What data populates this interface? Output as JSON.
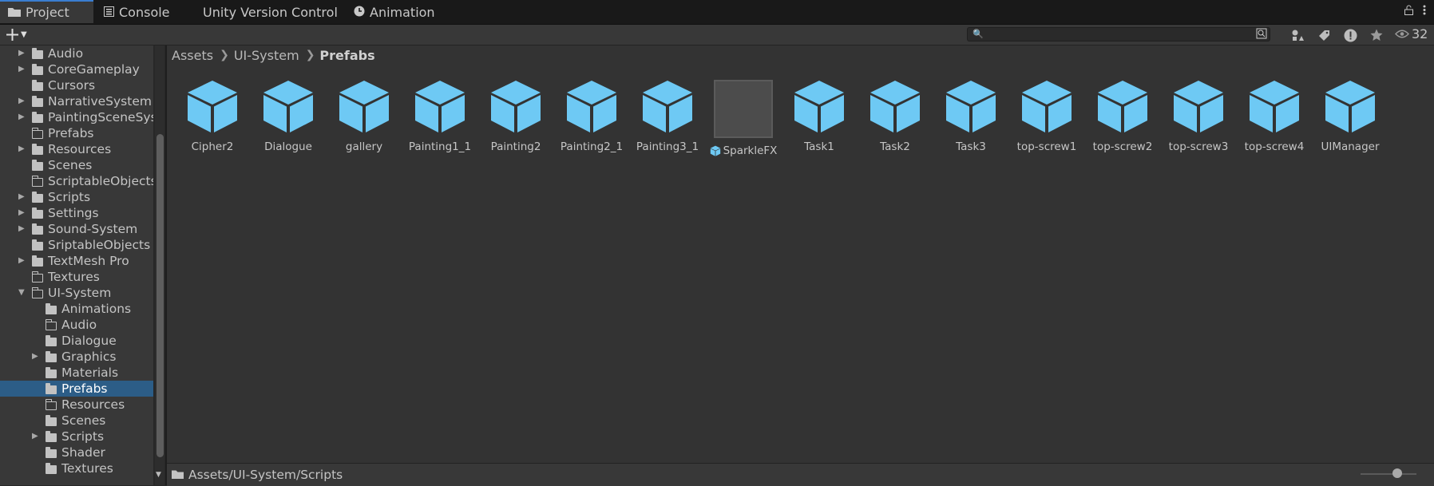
{
  "tabs": [
    {
      "label": "Project",
      "icon": "folder-icon",
      "active": true
    },
    {
      "label": "Console",
      "icon": "console-icon",
      "active": false
    },
    {
      "label": "Unity Version Control",
      "icon": "",
      "active": false
    },
    {
      "label": "Animation",
      "icon": "clock-icon",
      "active": false
    }
  ],
  "toolbar": {
    "create_icon": "plus-icon",
    "search_value": "",
    "visible_count": "32"
  },
  "tree": [
    {
      "label": "Audio",
      "expandable": true,
      "folder": "filled"
    },
    {
      "label": "CoreGameplay",
      "expandable": true,
      "folder": "filled"
    },
    {
      "label": "Cursors",
      "expandable": false,
      "folder": "filled"
    },
    {
      "label": "NarrativeSystem",
      "expandable": true,
      "folder": "filled"
    },
    {
      "label": "PaintingSceneSyst",
      "expandable": true,
      "folder": "filled"
    },
    {
      "label": "Prefabs",
      "expandable": false,
      "folder": "empty"
    },
    {
      "label": "Resources",
      "expandable": true,
      "folder": "filled"
    },
    {
      "label": "Scenes",
      "expandable": false,
      "folder": "filled"
    },
    {
      "label": "ScriptableObjects",
      "expandable": false,
      "folder": "empty"
    },
    {
      "label": "Scripts",
      "expandable": true,
      "folder": "filled"
    },
    {
      "label": "Settings",
      "expandable": true,
      "folder": "filled"
    },
    {
      "label": "Sound-System",
      "expandable": true,
      "folder": "filled"
    },
    {
      "label": "SriptableObjects",
      "expandable": false,
      "folder": "filled"
    },
    {
      "label": "TextMesh Pro",
      "expandable": true,
      "folder": "filled"
    },
    {
      "label": "Textures",
      "expandable": false,
      "folder": "empty"
    },
    {
      "label": "UI-System",
      "expandable": true,
      "expanded": true,
      "folder": "open"
    },
    {
      "label": "Animations",
      "expandable": false,
      "folder": "filled",
      "child": true
    },
    {
      "label": "Audio",
      "expandable": false,
      "folder": "empty",
      "child": true
    },
    {
      "label": "Dialogue",
      "expandable": false,
      "folder": "filled",
      "child": true
    },
    {
      "label": "Graphics",
      "expandable": true,
      "folder": "filled",
      "child": true
    },
    {
      "label": "Materials",
      "expandable": false,
      "folder": "filled",
      "child": true
    },
    {
      "label": "Prefabs",
      "expandable": false,
      "folder": "filled",
      "child": true,
      "selected": true
    },
    {
      "label": "Resources",
      "expandable": false,
      "folder": "empty",
      "child": true
    },
    {
      "label": "Scenes",
      "expandable": false,
      "folder": "filled",
      "child": true
    },
    {
      "label": "Scripts",
      "expandable": true,
      "folder": "filled",
      "child": true
    },
    {
      "label": "Shader",
      "expandable": false,
      "folder": "filled",
      "child": true
    },
    {
      "label": "Textures",
      "expandable": false,
      "folder": "filled",
      "child": true
    }
  ],
  "breadcrumb": [
    "Assets",
    "UI-System",
    "Prefabs"
  ],
  "assets": [
    {
      "name": "Cipher2",
      "kind": "prefab"
    },
    {
      "name": "Dialogue",
      "kind": "prefab"
    },
    {
      "name": "gallery",
      "kind": "prefab"
    },
    {
      "name": "Painting1_1",
      "kind": "prefab"
    },
    {
      "name": "Painting2",
      "kind": "prefab"
    },
    {
      "name": "Painting2_1",
      "kind": "prefab"
    },
    {
      "name": "Painting3_1",
      "kind": "prefab"
    },
    {
      "name": "SparkleFX",
      "kind": "fx"
    },
    {
      "name": "Task1",
      "kind": "prefab"
    },
    {
      "name": "Task2",
      "kind": "prefab"
    },
    {
      "name": "Task3",
      "kind": "prefab"
    },
    {
      "name": "top-screw1",
      "kind": "prefab"
    },
    {
      "name": "top-screw2",
      "kind": "prefab"
    },
    {
      "name": "top-screw3",
      "kind": "prefab"
    },
    {
      "name": "top-screw4",
      "kind": "prefab"
    },
    {
      "name": "UIManager",
      "kind": "prefab"
    }
  ],
  "footer": {
    "path": "Assets/UI-System/Scripts"
  },
  "colors": {
    "prefab_cube": "#6ec9f4",
    "selection": "#2c5d87",
    "active_tab_accent": "#3a7dd0"
  }
}
